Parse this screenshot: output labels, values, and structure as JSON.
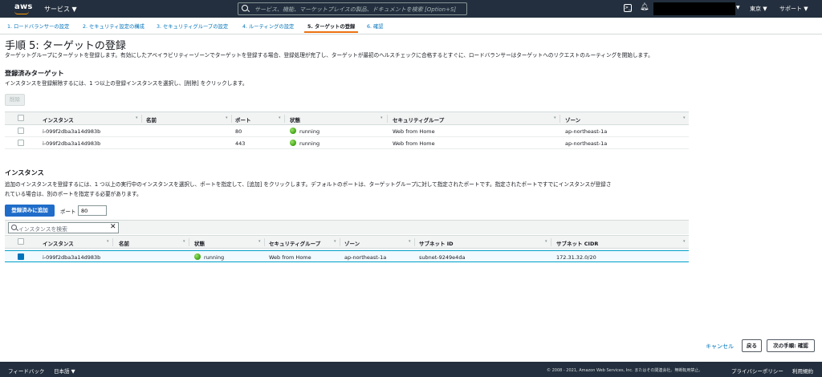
{
  "topbar": {
    "logo": "aws",
    "services": "サービス ▼",
    "search_placeholder": "サービス、機能、マーケットプレイスの製品、ドキュメントを検索 [Option+S]",
    "region": "東京 ▼",
    "support": "サポート ▼"
  },
  "steps": [
    "1. ロードバランサーの設定",
    "2. セキュリティ設定の構成",
    "3. セキュリティグループの設定",
    "4. ルーティングの設定",
    "5. ターゲットの登録",
    "6. 確認"
  ],
  "page": {
    "title": "手順 5: ターゲットの登録",
    "description": "ターゲットグループにターゲットを登録します。有効にしたアベイラビリティーゾーンでターゲットを登録する場合、登録処理が完了し、ターゲットが最初のヘルスチェックに合格するとすぐに、ロードバランサーはターゲットへのリクエストのルーティングを開始します。"
  },
  "registered": {
    "heading": "登録済みターゲット",
    "instruction": "インスタンスを登録解除するには、1 つ以上の登録インスタンスを選択し、[削除] をクリックします。",
    "remove_label": "削除",
    "columns": [
      "インスタンス",
      "名前",
      "ポート",
      "状態",
      "セキュリティグループ",
      "ゾーン"
    ],
    "rows": [
      {
        "instance": "i-099f2dba3a14d983b",
        "name": "",
        "port": "80",
        "state": "running",
        "sg": "Web from Home",
        "zone": "ap-northeast-1a"
      },
      {
        "instance": "i-099f2dba3a14d983b",
        "name": "",
        "port": "443",
        "state": "running",
        "sg": "Web from Home",
        "zone": "ap-northeast-1a"
      }
    ]
  },
  "instances": {
    "heading": "インスタンス",
    "instruction_1": "追加のインスタンスを登録するには、1 つ以上の実行中のインスタンスを選択し、ポートを指定して、[追加] をクリックします。デフォルトのポートは、ターゲットグループに対して指定されたポートです。指定されたポートですでにインスタンスが登録さ",
    "instruction_2": "れている場合は、別のポートを指定する必要があります。",
    "add_label": "登録済みに追加",
    "port_label": "ポート",
    "port_value": "80",
    "search_placeholder": "インスタンスを検索",
    "columns": [
      "インスタンス",
      "名前",
      "状態",
      "セキュリティグループ",
      "ゾーン",
      "サブネット ID",
      "サブネット CIDR"
    ],
    "rows": [
      {
        "instance": "i-099f2dba3a14d983b",
        "name": "",
        "state": "running",
        "sg": "Web from Home",
        "zone": "ap-northeast-1a",
        "subnet": "subnet-9249e4da",
        "cidr": "172.31.32.0/20",
        "selected": true
      }
    ]
  },
  "actions": {
    "cancel": "キャンセル",
    "back": "戻る",
    "next": "次の手順: 確認"
  },
  "footer": {
    "feedback": "フィードバック",
    "language": "日本語 ▼",
    "copyright": "© 2008 - 2021, Amazon Web Services, Inc. またはその関連会社。無断転用禁止。",
    "privacy": "プライバシーポリシー",
    "terms": "利用規約"
  },
  "colors": {
    "topbar": "#232f3e",
    "primary": "#1f6cc9",
    "link": "#0073bb",
    "active_tab": "#ec7211",
    "running": "#3ca20f"
  }
}
